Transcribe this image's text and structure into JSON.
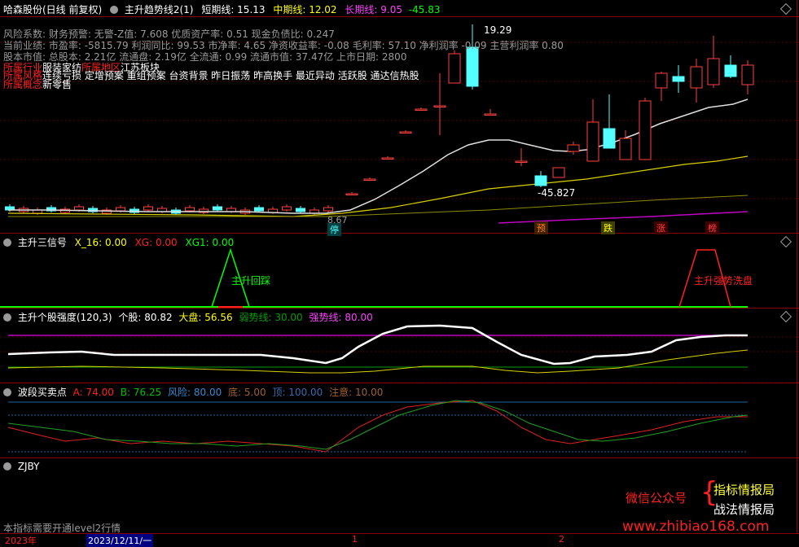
{
  "header": {
    "stock": "哈森股份(日线 前复权)",
    "indicator": "主升趋势线2(1)",
    "short_label": "短期线: 15.13",
    "mid_label": "中期线: 12.02",
    "long_label": "长期线: 9.05",
    "long_extra": "-45.83"
  },
  "info": {
    "line1": "风险系数: 财务预警: 无警-Z值: 7.608 优质资产率: 0.51 现金负债比: 0.247",
    "line2": "当前业绩: 市盈率: -5815.79 利润同比: 99.53 市净率: 4.65 净资收益率: -0.08 毛利率: 57.10 净利润率 -0.09 主营利润率 0.80",
    "line3": "股本市值: 总股本: 2.21亿 流通盘: 2.19亿 全流通: 0.99 流通市值: 37.47亿 上市日期: 2800",
    "industry_label": "所属行业",
    "industry_value": "服装家纺",
    "region_label": "所属地区",
    "region_value": "江苏板块",
    "style_label": "所属风格",
    "style_value": "连续亏损 定增预案 重组预案 台资背景 昨日振荡 昨高换手 最近异动 活跃股 通达信热股",
    "concept_label": "所属概念",
    "concept_value": "新零售"
  },
  "price_labels": {
    "high": "19.29",
    "low": "-45.827",
    "left_low": "8.67",
    "ting": "停",
    "yu": "预",
    "die": "跌",
    "zhang": "涨",
    "bang": "榜"
  },
  "panel2": {
    "title": "主升三信号",
    "x16": "X_16: 0.00",
    "xg": "XG: 0.00",
    "xg1": "XG1: 0.00",
    "label_green": "主升回踩",
    "label_red": "主升强势洗盘"
  },
  "panel3": {
    "title": "主升个股强度(120,3)",
    "stock": "个股: 80.82",
    "market": "大盘: 56.56",
    "weak": "弱势线: 30.00",
    "strong": "强势线: 80.00"
  },
  "panel4": {
    "title": "波段买卖点",
    "a": "A: 74.00",
    "b": "B: 76.25",
    "risk": "风险: 80.00",
    "bottom": "底: 5.00",
    "top": "顶: 100.00",
    "notice": "注意: 10.00"
  },
  "panel5": {
    "title": "ZJBY"
  },
  "footer": {
    "note": "本指标需要开通level2行情",
    "year": "2023年",
    "date": "2023/12/11/一",
    "tick1": "1",
    "tick2": "2"
  },
  "watermark": {
    "wechat": "微信公众号",
    "line1": "指标情报局",
    "line2": "战法情报局",
    "url": "www.zhibiao168.com"
  },
  "colors": {
    "up": "#ff4040",
    "down": "#54ffff",
    "white": "#ffffff",
    "yellow": "#ffff00",
    "magenta": "#ff00ff",
    "green": "#00ff00",
    "border": "#8b0000"
  }
}
